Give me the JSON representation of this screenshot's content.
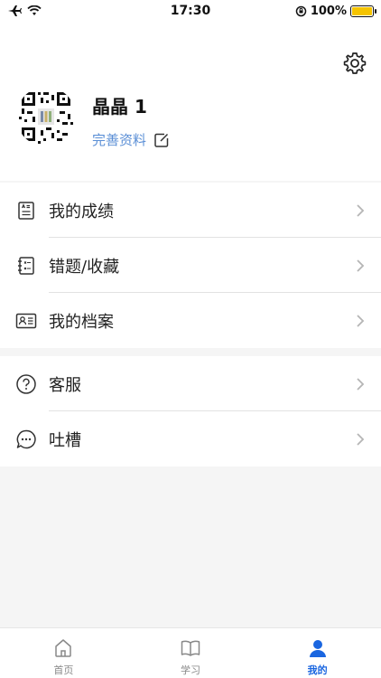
{
  "status_bar": {
    "time": "17:30",
    "battery_pct": "100%"
  },
  "profile": {
    "username": "晶晶 1",
    "edit_label": "完善资料"
  },
  "menu_group_1": [
    {
      "label": "我的成绩",
      "icon": "report-icon"
    },
    {
      "label": "错题/收藏",
      "icon": "notebook-icon"
    },
    {
      "label": "我的档案",
      "icon": "id-card-icon"
    }
  ],
  "menu_group_2": [
    {
      "label": "客服",
      "icon": "help-icon"
    },
    {
      "label": "吐槽",
      "icon": "chat-icon"
    }
  ],
  "tabs": [
    {
      "label": "首页",
      "icon": "home-icon",
      "active": false
    },
    {
      "label": "学习",
      "icon": "book-icon",
      "active": false
    },
    {
      "label": "我的",
      "icon": "user-icon",
      "active": true
    }
  ],
  "colors": {
    "accent": "#1a66e0",
    "link": "#5b8fd6",
    "battery": "#f5c400"
  }
}
